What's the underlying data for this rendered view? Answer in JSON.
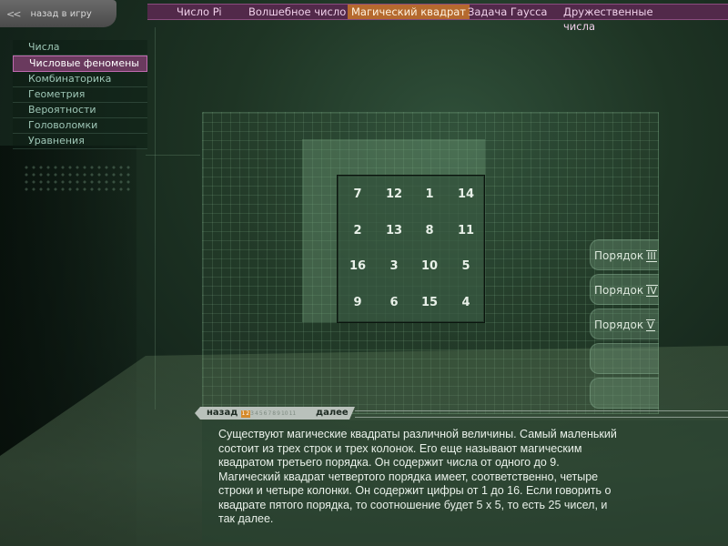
{
  "back": {
    "icon": "double-chevron-left-icon",
    "label": "назад в игру"
  },
  "menu": {
    "items": [
      {
        "label": "Числа",
        "active": false
      },
      {
        "label": "Числовые феномены",
        "active": true
      },
      {
        "label": "Комбинаторика",
        "active": false
      },
      {
        "label": "Геометрия",
        "active": false
      },
      {
        "label": "Вероятности",
        "active": false
      },
      {
        "label": "Головоломки",
        "active": false
      },
      {
        "label": "Уравнения",
        "active": false
      }
    ]
  },
  "topnav": {
    "tabs": [
      {
        "label": "Число Pi"
      },
      {
        "label": "Волшебное число"
      },
      {
        "label": "Магический квадрат"
      },
      {
        "label": "Задача Гаусса"
      },
      {
        "label": "Дружественные",
        "label2": "числа"
      }
    ],
    "active_index": 2
  },
  "square": {
    "rows": [
      [
        "7",
        "12",
        "1",
        "14"
      ],
      [
        "2",
        "13",
        "8",
        "11"
      ],
      [
        "16",
        "3",
        "10",
        "5"
      ],
      [
        "9",
        "6",
        "15",
        "4"
      ]
    ]
  },
  "orders": [
    {
      "label": "Порядок",
      "roman": "III"
    },
    {
      "label": "Порядок",
      "roman": "IV"
    },
    {
      "label": "Порядок",
      "roman": "V"
    }
  ],
  "pager": {
    "prev": "назад",
    "next": "далее",
    "pages": [
      "1",
      "2",
      "3",
      "4",
      "5",
      "6",
      "7",
      "8",
      "9",
      "10",
      "11"
    ],
    "current": [
      "1",
      "2"
    ]
  },
  "description": "Существуют магические квадраты различной величины. Самый маленький состоит из трех строк и трех колонок. Его еще называют магическим квадратом третьего порядка. Он содержит числа от одного до 9. Магический квадрат четвертого порядка имеет, соответственно, четыре строки и четыре колонки. Он содержит цифры от 1 до 16. Если говорить о квадрате пятого порядка, то соотношение будет 5 х 5, то есть 25 чисел, и так далее.",
  "colors": {
    "accent_active_tab": "#b5692e",
    "nav_bg": "#52294a",
    "menu_active": "#6a3a5e"
  }
}
